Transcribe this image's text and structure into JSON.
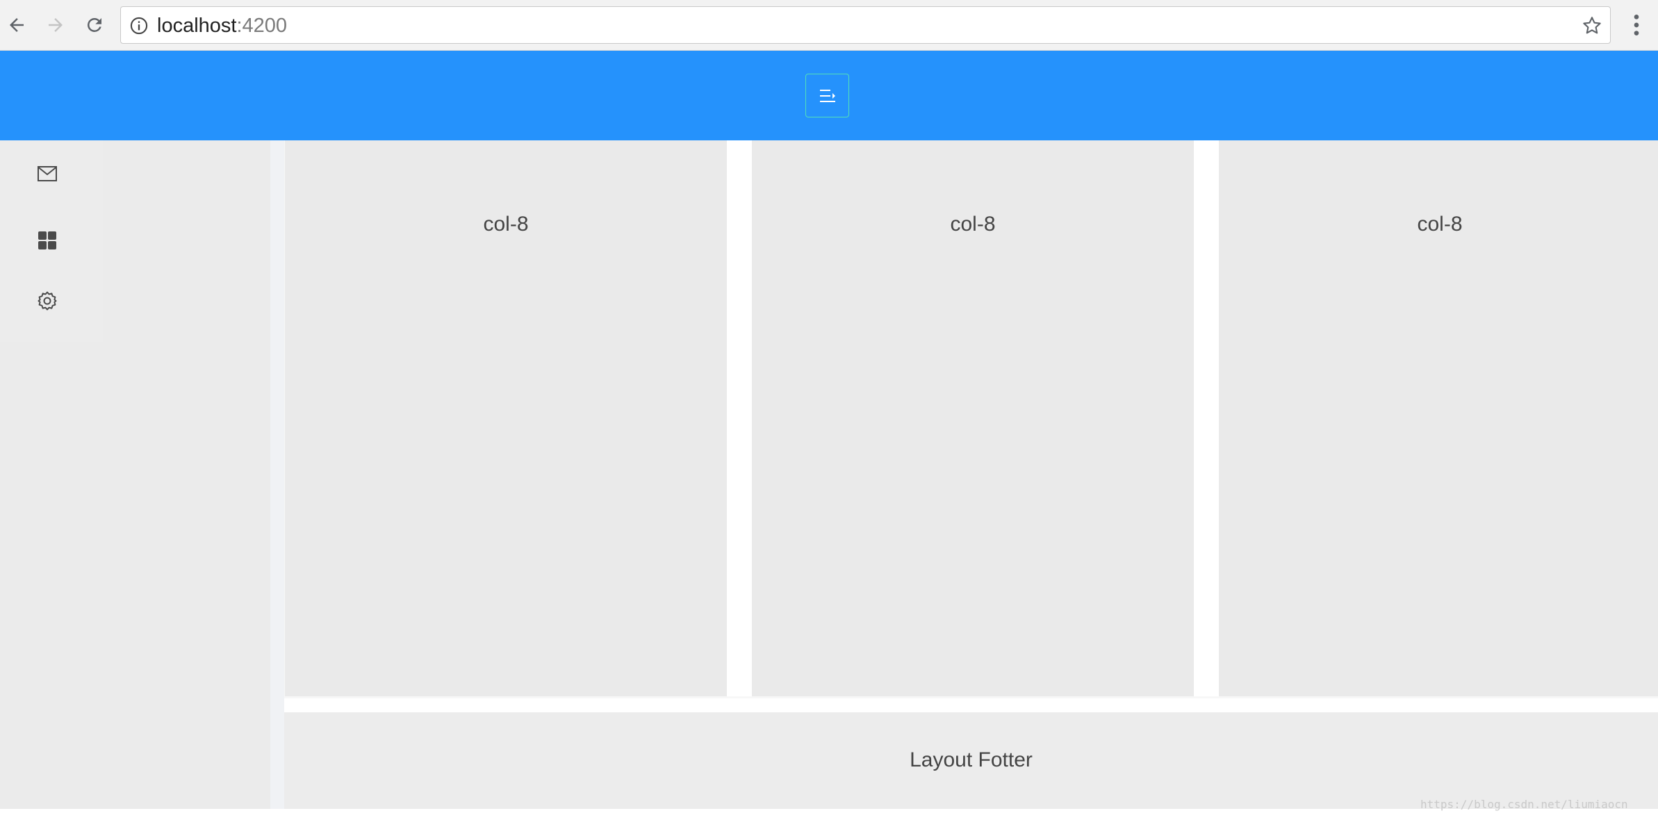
{
  "browser": {
    "url_host": "localhost",
    "url_port": ":4200",
    "icons": {
      "back": "arrow-left-icon",
      "forward": "arrow-right-icon",
      "reload": "reload-icon",
      "info": "info-circle-icon",
      "bookmark": "star-icon",
      "menu": "vertical-dots-icon"
    }
  },
  "header": {
    "background_color": "#2592fc",
    "toggle_icon": "menu-unfold-icon",
    "toggle_border_color": "#52e0b8"
  },
  "sidebar": {
    "items": [
      {
        "icon": "mail-icon"
      },
      {
        "icon": "appstore-icon"
      },
      {
        "icon": "setting-icon"
      }
    ]
  },
  "content": {
    "columns": [
      {
        "label": "col-8"
      },
      {
        "label": "col-8"
      },
      {
        "label": "col-8"
      }
    ]
  },
  "footer": {
    "text": "Layout Fotter"
  },
  "watermark": {
    "text": "https://blog.csdn.net/liumiaocn"
  }
}
